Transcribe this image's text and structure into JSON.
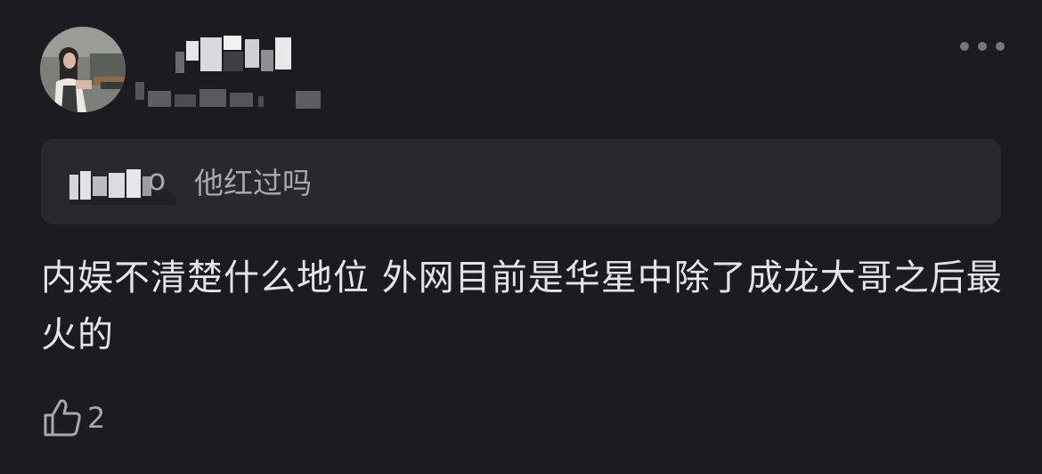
{
  "comment": {
    "quote": {
      "name_suffix": "o",
      "text": "他红过吗"
    },
    "body": "内娱不清楚什么地位 外网目前是华星中除了成龙大哥之后最火的",
    "likes": "2"
  },
  "icons": {
    "more": "more-dots-icon",
    "like": "thumbs-up-icon"
  },
  "colors": {
    "background": "#1c1b20",
    "quote_background": "#29282d",
    "primary_text": "#e4e4e6",
    "secondary_text": "#a9a9ad"
  }
}
